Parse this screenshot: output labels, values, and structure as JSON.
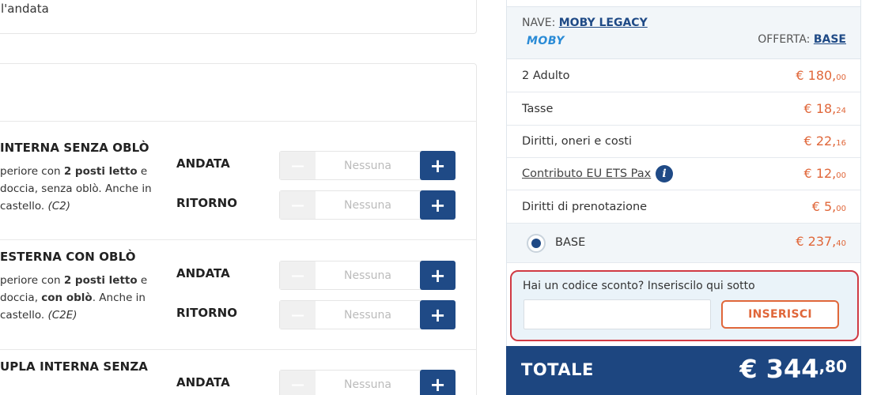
{
  "top_card": {
    "text": "l'andata"
  },
  "cabins": [
    {
      "title": "INTERNA SENZA OBLÒ",
      "desc_parts": [
        "periore con ",
        "2 posti letto",
        " e",
        "doccia, senza oblò. Anche in",
        "castello. ",
        "(C2)"
      ],
      "andata": {
        "label": "ANDATA",
        "value": "Nessuna"
      },
      "ritorno": {
        "label": "RITORNO",
        "value": "Nessuna"
      }
    },
    {
      "title": "ESTERNA CON OBLÒ",
      "desc_parts": [
        "periore con ",
        "2 posti letto",
        " e",
        "doccia, ",
        "con oblò",
        ". Anche in",
        "castello. ",
        "(C2E)"
      ],
      "andata": {
        "label": "ANDATA",
        "value": "Nessuna"
      },
      "ritorno": {
        "label": "RITORNO",
        "value": "Nessuna"
      }
    },
    {
      "title": "UPLA INTERNA SENZA",
      "andata": {
        "label": "ANDATA",
        "value": "Nessuna"
      }
    }
  ],
  "stepper_symbols": {
    "minus": "−",
    "plus": "+"
  },
  "summary": {
    "nave_label": "NAVE: ",
    "nave_name": "MOBY LEGACY",
    "logo_text": "MOBY",
    "offerta_label": "OFFERTA: ",
    "offerta_value": "BASE",
    "rows": [
      {
        "label": "2 Adulto",
        "price_int": "€ 180,",
        "price_dec": "00"
      },
      {
        "label": "Tasse",
        "price_int": "€ 18,",
        "price_dec": "24"
      },
      {
        "label": "Diritti, oneri e costi",
        "price_int": "€ 22,",
        "price_dec": "16"
      },
      {
        "label": "Contributo EU ETS Pax ",
        "price_int": "€ 12,",
        "price_dec": "00"
      },
      {
        "label": "Diritti di prenotazione",
        "price_int": "€ 5,",
        "price_dec": "00"
      }
    ],
    "base_row": {
      "label": "BASE",
      "price_int": "€ 237,",
      "price_dec": "40"
    },
    "info_icon": "i"
  },
  "coupon": {
    "question": "Hai un codice sconto? Inseriscilo qui sotto",
    "input_value": "",
    "button_label": "INSERISCI"
  },
  "total": {
    "label": "TOTALE",
    "amount_int": "€ 344",
    "amount_dec": ",80"
  },
  "colors": {
    "primary": "#1f4a86",
    "accent": "#e0673a",
    "highlight": "#d03a44"
  }
}
